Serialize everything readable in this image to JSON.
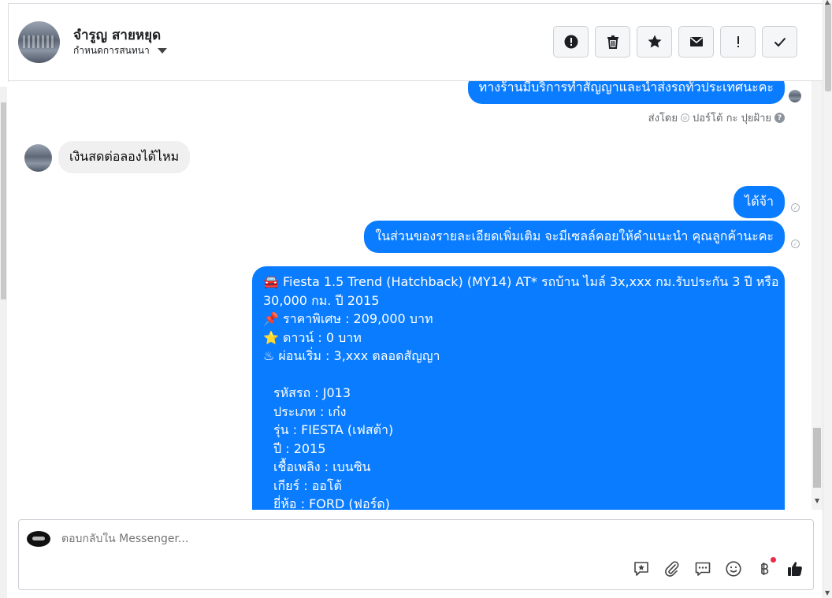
{
  "header": {
    "contact_name": "จำรูญ สายหยุด",
    "assign_label": "กำหนดการสนทนา",
    "actions": [
      {
        "icon": "alert-circle-icon"
      },
      {
        "icon": "trash-icon"
      },
      {
        "icon": "star-icon"
      },
      {
        "icon": "envelope-icon"
      },
      {
        "icon": "exclamation-icon"
      },
      {
        "icon": "checkmark-icon"
      }
    ]
  },
  "messages": {
    "msg1_text": "ทางร้านมีบริการทำสัญญาและนำส่งรถทั่วประเทศนะคะ",
    "sent_by_prefix": "ส่งโดย",
    "sent_by_name": "ปอร์โต้ กะ ปุยฝ้าย",
    "help_mark": "?",
    "msg2_text": "เงินสดต่อลองได้ไหม",
    "msg3_text": "ได้จ้า",
    "msg4_text": "ในส่วนของรายละเอียดเพิ่มเติม จะมีเซลล์คอยให้คำแนะนำ คุณลูกค้านะคะ",
    "card": {
      "line1": "🚘 Fiesta 1.5 Trend (Hatchback) (MY14) AT* รถบ้าน ไมล์ 3x,xxx กม.รับประกัน 3 ปี หรือ",
      "line2": "30,000 กม. ปี 2015",
      "line3": "📌 ราคาพิเศษ : 209,000 บาท",
      "line4": "⭐ ดาวน์ : 0 บาท",
      "line5": "♨ ผ่อนเริ่ม : 3,xxx ตลอดสัญญา",
      "line6": "รหัสรถ : J013",
      "line7": "ประเภท : เก๋ง",
      "line8": "รุ่น : FIESTA (เฟสต้า)",
      "line9": "ปี : 2015",
      "line10": "เชื้อเพลิง : เบนซิน",
      "line11": "เกียร์ : ออโต้",
      "line12": "ยี่ห้อ : FORD (ฟอร์ด)"
    }
  },
  "composer": {
    "placeholder": "ตอบกลับใน Messenger...",
    "tools": [
      "saved-reply-icon",
      "attachment-icon",
      "chat-bubble-icon",
      "emoji-icon",
      "baht-icon",
      "thumbs-up-icon"
    ],
    "accent_color": "#0a7cff",
    "notification_color": "#f02849"
  }
}
